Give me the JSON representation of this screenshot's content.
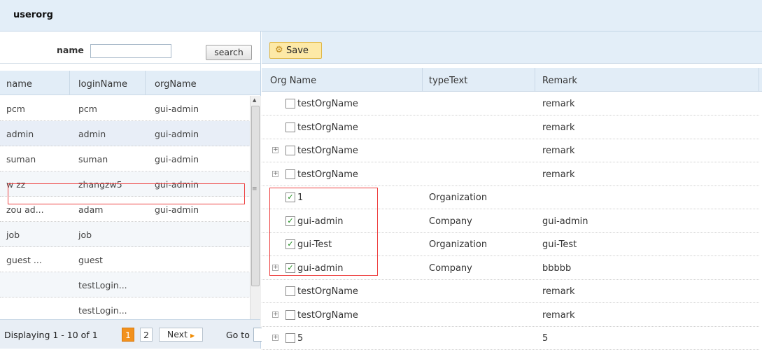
{
  "panel": {
    "title": "userorg"
  },
  "search": {
    "label": "name",
    "value": "",
    "button": "search"
  },
  "left_table": {
    "columns": [
      "name",
      "loginName",
      "orgName"
    ],
    "rows": [
      {
        "name": "pcm",
        "loginName": "pcm",
        "orgName": "gui-admin"
      },
      {
        "name": "admin",
        "loginName": "admin",
        "orgName": "gui-admin"
      },
      {
        "name": "suman",
        "loginName": "suman",
        "orgName": "gui-admin"
      },
      {
        "name": "w zz",
        "loginName": "zhangzw5",
        "orgName": "gui-admin"
      },
      {
        "name": "zou ad...",
        "loginName": "adam",
        "orgName": "gui-admin"
      },
      {
        "name": "job",
        "loginName": "job",
        "orgName": ""
      },
      {
        "name": "guest ...",
        "loginName": "guest",
        "orgName": ""
      },
      {
        "name": "",
        "loginName": "testLogin...",
        "orgName": ""
      },
      {
        "name": "",
        "loginName": "testLogin...",
        "orgName": ""
      }
    ],
    "selected_row_index": 1
  },
  "pager": {
    "text": "Displaying 1 - 10 of 1",
    "page1": "1",
    "page2": "2",
    "next": "Next",
    "goto": "Go to"
  },
  "toolbar": {
    "save_label": "Save"
  },
  "right_table": {
    "columns": [
      "Org Name",
      "typeText",
      "Remark"
    ],
    "rows": [
      {
        "expander": false,
        "checked": false,
        "orgName": "testOrgName",
        "typeText": "",
        "remark": "remark"
      },
      {
        "expander": false,
        "checked": false,
        "orgName": "testOrgName",
        "typeText": "",
        "remark": "remark"
      },
      {
        "expander": true,
        "checked": false,
        "orgName": "testOrgName",
        "typeText": "",
        "remark": "remark"
      },
      {
        "expander": true,
        "checked": false,
        "orgName": "testOrgName",
        "typeText": "",
        "remark": "remark"
      },
      {
        "expander": false,
        "checked": true,
        "orgName": "1",
        "typeText": "Organization",
        "remark": ""
      },
      {
        "expander": false,
        "checked": true,
        "orgName": "gui-admin",
        "typeText": "Company",
        "remark": "gui-admin"
      },
      {
        "expander": false,
        "checked": true,
        "orgName": "gui-Test",
        "typeText": "Organization",
        "remark": "gui-Test"
      },
      {
        "expander": true,
        "checked": true,
        "orgName": "gui-admin",
        "typeText": "Company",
        "remark": "bbbbb"
      },
      {
        "expander": false,
        "checked": false,
        "orgName": "testOrgName",
        "typeText": "",
        "remark": "remark"
      },
      {
        "expander": true,
        "checked": false,
        "orgName": "testOrgName",
        "typeText": "",
        "remark": "remark"
      },
      {
        "expander": true,
        "checked": false,
        "orgName": "5",
        "typeText": "",
        "remark": "5"
      }
    ]
  },
  "colors": {
    "header_bg": "#e3eef8",
    "selected_row_bg": "#e8eef7",
    "highlight_border": "#e44444",
    "page_active": "#f2911d",
    "save_bg": "#fde9a7"
  }
}
